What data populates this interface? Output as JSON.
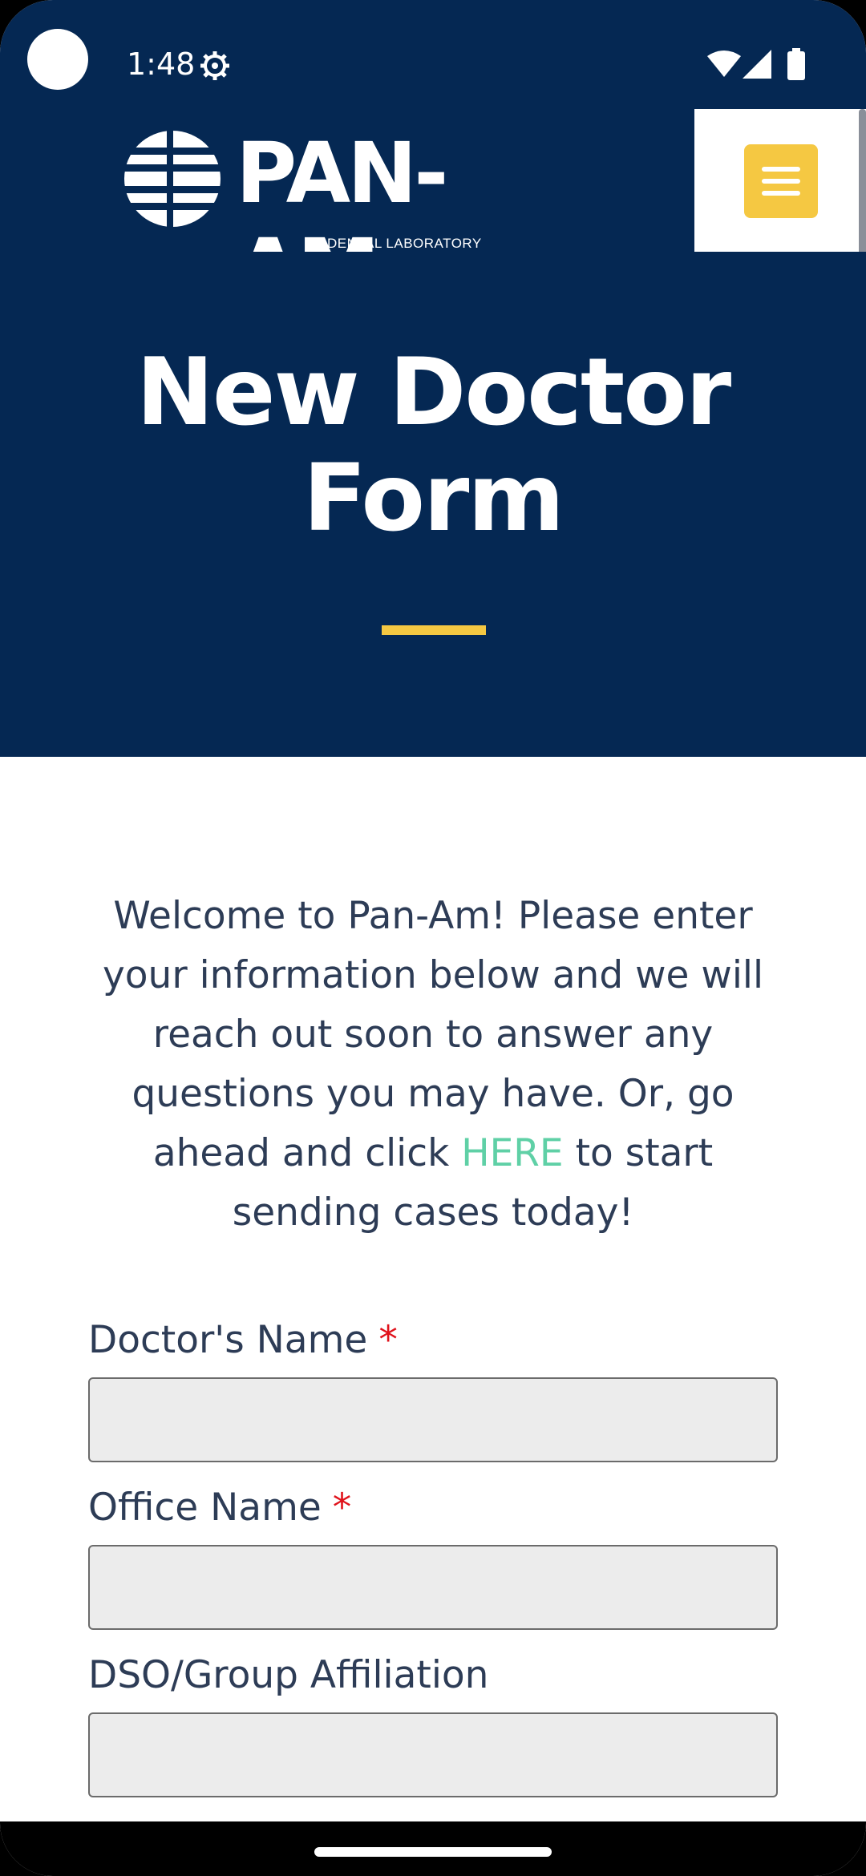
{
  "status_bar": {
    "time": "1:48",
    "icons": [
      "gear-icon",
      "wifi-icon",
      "signal-icon",
      "battery-icon"
    ]
  },
  "header": {
    "logo_text": "PAN-AM",
    "logo_subtext": "DENTAL LABORATORY",
    "menu_icon": "hamburger-menu-icon"
  },
  "hero": {
    "title_line1": "New Doctor",
    "title_line2": "Form"
  },
  "intro": {
    "text_before": "Welcome to Pan-Am! Please enter your information below and we will reach out soon to answer any questions you may have. Or, go ahead and click ",
    "link_text": "HERE",
    "text_after": " to start sending cases today!"
  },
  "form": {
    "fields": [
      {
        "label": "Doctor's Name",
        "required_mark": "*",
        "value": ""
      },
      {
        "label": "Office Name",
        "required_mark": "*",
        "value": ""
      },
      {
        "label": "DSO/Group Affiliation",
        "value": ""
      }
    ]
  },
  "colors": {
    "navy": "#052853",
    "accent_yellow": "#f5c842",
    "link_green": "#5fd0a6",
    "text": "#2d3c56",
    "required_red": "#e0121b"
  }
}
